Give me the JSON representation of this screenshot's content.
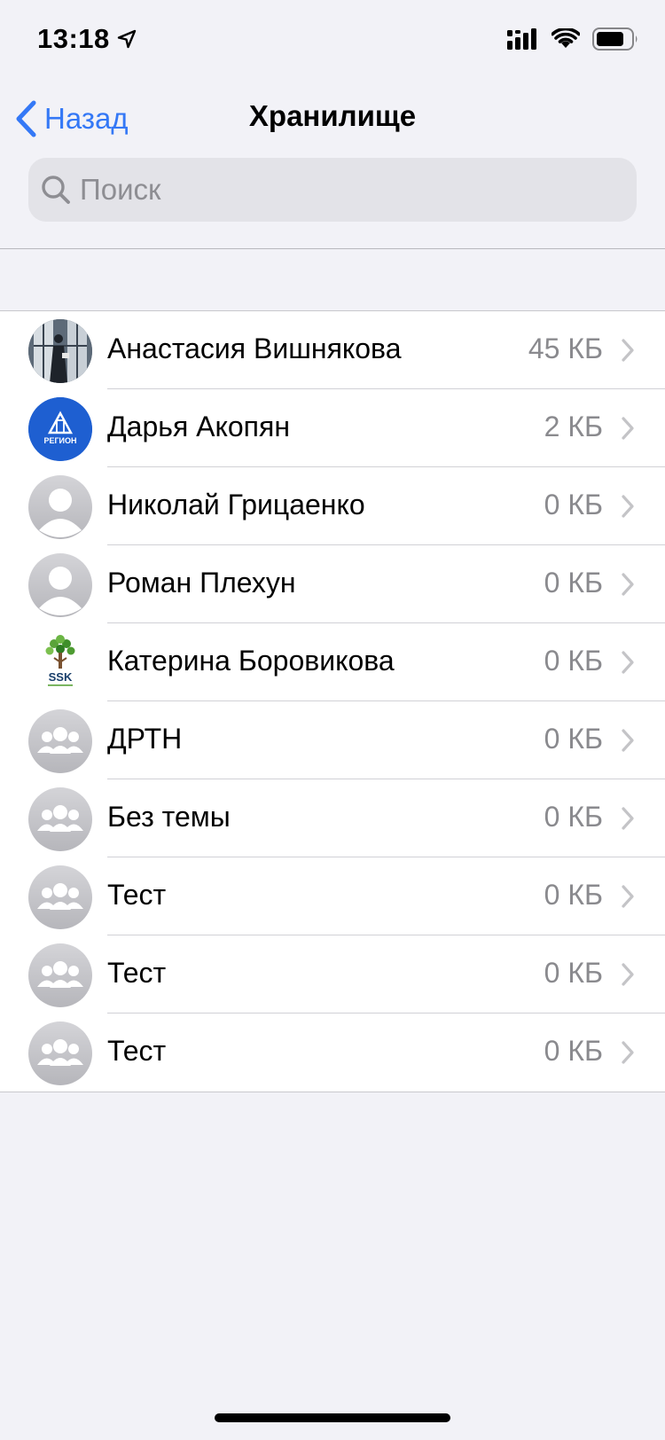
{
  "status_bar": {
    "time": "13:18"
  },
  "nav": {
    "back_label": "Назад",
    "title": "Хранилище"
  },
  "search": {
    "placeholder": "Поиск",
    "value": ""
  },
  "colors": {
    "accent": "#3478f6",
    "secondary_text": "#8a8a8e",
    "background": "#f2f2f7"
  },
  "items": [
    {
      "name": "Анастасия Вишнякова",
      "size": "45 КБ",
      "avatar": "photo"
    },
    {
      "name": "Дарья Акопян",
      "size": "2 КБ",
      "avatar": "region-logo"
    },
    {
      "name": "Николай Грицаенко",
      "size": "0 КБ",
      "avatar": "person-placeholder"
    },
    {
      "name": "Роман Плехун",
      "size": "0 КБ",
      "avatar": "person-placeholder"
    },
    {
      "name": "Катерина Боровикова",
      "size": "0 КБ",
      "avatar": "ssk-logo"
    },
    {
      "name": "ДРТН",
      "size": "0 КБ",
      "avatar": "group-placeholder"
    },
    {
      "name": "Без темы",
      "size": "0 КБ",
      "avatar": "group-placeholder"
    },
    {
      "name": "Тест",
      "size": "0 КБ",
      "avatar": "group-placeholder"
    },
    {
      "name": "Тест",
      "size": "0 КБ",
      "avatar": "group-placeholder"
    },
    {
      "name": "Тест",
      "size": "0 КБ",
      "avatar": "group-placeholder"
    }
  ],
  "logos": {
    "region_text": "РЕГИОН",
    "ssk_text": "SSK"
  }
}
